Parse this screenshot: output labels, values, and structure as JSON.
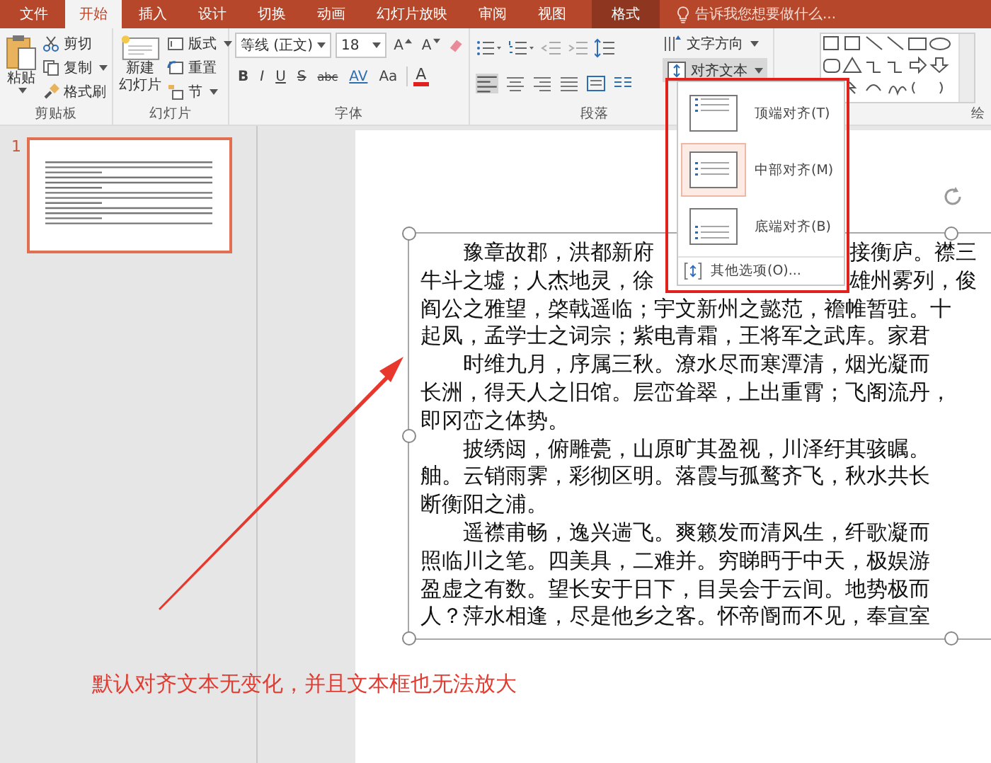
{
  "tabs": [
    {
      "label": "文件",
      "selected": false,
      "kind": "normal"
    },
    {
      "label": "开始",
      "selected": true,
      "kind": "normal"
    },
    {
      "label": "插入",
      "selected": false,
      "kind": "normal"
    },
    {
      "label": "设计",
      "selected": false,
      "kind": "normal"
    },
    {
      "label": "切换",
      "selected": false,
      "kind": "normal"
    },
    {
      "label": "动画",
      "selected": false,
      "kind": "normal"
    },
    {
      "label": "幻灯片放映",
      "selected": false,
      "kind": "normal"
    },
    {
      "label": "审阅",
      "selected": false,
      "kind": "normal"
    },
    {
      "label": "视图",
      "selected": false,
      "kind": "normal"
    },
    {
      "label": "格式",
      "selected": false,
      "kind": "contextual"
    }
  ],
  "tell_me": {
    "placeholder": "告诉我您想要做什么..."
  },
  "clipboard": {
    "label": "剪贴板",
    "paste": "粘贴",
    "cut": "剪切",
    "copy": "复制",
    "format_painter": "格式刷"
  },
  "slides": {
    "label": "幻灯片",
    "new_slide_1": "新建",
    "new_slide_2": "幻灯片",
    "layout": "版式",
    "reset": "重置",
    "section": "节"
  },
  "font": {
    "label": "字体",
    "font_name": "等线 (正文)",
    "font_size": "18",
    "grow": "A",
    "shrink": "A",
    "format_buttons": [
      "B",
      "I",
      "U",
      "S",
      "abc",
      "AV",
      "Aa"
    ],
    "font_color": "A"
  },
  "paragraph": {
    "label": "段落",
    "text_direction": "文字方向",
    "align_text": "对齐文本"
  },
  "drawing": {
    "label": "绘"
  },
  "align_menu": {
    "items": [
      {
        "label": "顶端对齐(T)",
        "selected": false,
        "kind": "top"
      },
      {
        "label": "中部对齐(M)",
        "selected": true,
        "kind": "middle"
      },
      {
        "label": "底端对齐(B)",
        "selected": false,
        "kind": "bottom"
      }
    ],
    "more": "其他选项(O)..."
  },
  "slide_panel": {
    "number": "1"
  },
  "text_box": {
    "paragraphs": [
      {
        "lines": [
          [
            "豫章故郡，洪都新府",
            "接衡庐。襟三"
          ],
          [
            "牛斗之墟；人杰地灵，徐",
            "雄州雾列，俊"
          ],
          [
            "阎公之雅望，棨戟遥临；宇文新州之懿范，襜帷暂驻。十"
          ],
          [
            "起凤，孟学士之词宗；紫电青霜，王将军之武库。家君"
          ]
        ]
      },
      {
        "lines": [
          [
            "时维九月，序属三秋。潦水尽而寒潭清，烟光凝而"
          ],
          [
            "长洲，得天人之旧馆。层峦耸翠，上出重霄；飞阁流丹，"
          ],
          [
            "即冈峦之体势。"
          ]
        ]
      },
      {
        "lines": [
          [
            "披绣闼，俯雕甍，山原旷其盈视，川泽纡其骇瞩。"
          ],
          [
            "舳。云销雨霁，彩彻区明。落霞与孤鹜齐飞，秋水共长"
          ],
          [
            "断衡阳之浦。"
          ]
        ]
      },
      {
        "lines": [
          [
            "遥襟甫畅，逸兴遄飞。爽籁发而清风生，纤歌凝而"
          ],
          [
            "照临川之笔。四美具，二难并。穷睇眄于中天，极娱游"
          ],
          [
            "盈虚之有数。望长安于日下，目吴会于云间。地势极而"
          ],
          [
            "人？萍水相逢，尽是他乡之客。怀帝阍而不见，奉宣室"
          ]
        ]
      }
    ]
  },
  "annotation": {
    "text": "默认对齐文本无变化，并且文本框也无法放大"
  }
}
